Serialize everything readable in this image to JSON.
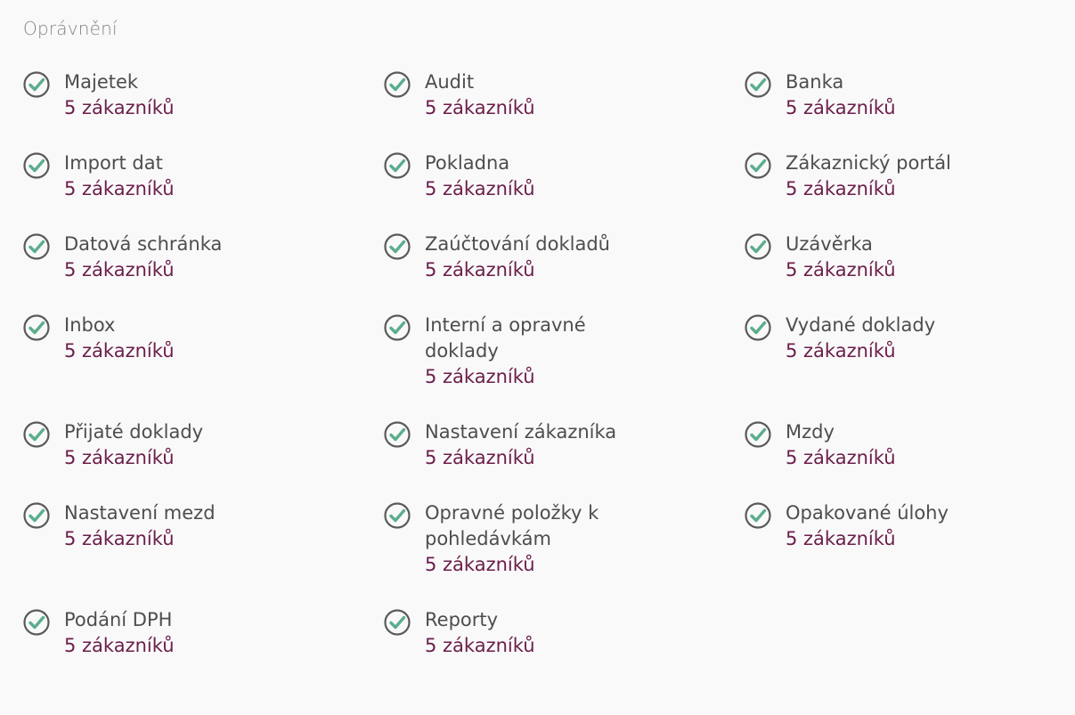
{
  "section": {
    "title": "Oprávnění"
  },
  "colors": {
    "check": "#5aae8c",
    "name": "#4d4d4d",
    "count": "#6b1e4a"
  },
  "permissions": [
    {
      "name": "Majetek",
      "count": "5 zákazníků"
    },
    {
      "name": "Audit",
      "count": "5 zákazníků"
    },
    {
      "name": "Banka",
      "count": "5 zákazníků"
    },
    {
      "name": "Import dat",
      "count": "5 zákazníků"
    },
    {
      "name": "Pokladna",
      "count": "5 zákazníků"
    },
    {
      "name": "Zákaznický portál",
      "count": "5 zákazníků"
    },
    {
      "name": "Datová schránka",
      "count": "5 zákazníků"
    },
    {
      "name": "Zaúčtování dokladů",
      "count": "5 zákazníků"
    },
    {
      "name": "Uzávěrka",
      "count": "5 zákazníků"
    },
    {
      "name": "Inbox",
      "count": "5 zákazníků"
    },
    {
      "name": "Interní a opravné doklady",
      "count": "5 zákazníků"
    },
    {
      "name": "Vydané doklady",
      "count": "5 zákazníků"
    },
    {
      "name": "Přijaté doklady",
      "count": "5 zákazníků"
    },
    {
      "name": "Nastavení zákazníka",
      "count": "5 zákazníků"
    },
    {
      "name": "Mzdy",
      "count": "5 zákazníků"
    },
    {
      "name": "Nastavení mezd",
      "count": "5 zákazníků"
    },
    {
      "name": "Opravné položky k pohledávkám",
      "count": "5 zákazníků"
    },
    {
      "name": "Opakované úlohy",
      "count": "5 zákazníků"
    },
    {
      "name": "Podání DPH",
      "count": "5 zákazníků"
    },
    {
      "name": "Reporty",
      "count": "5 zákazníků"
    }
  ]
}
